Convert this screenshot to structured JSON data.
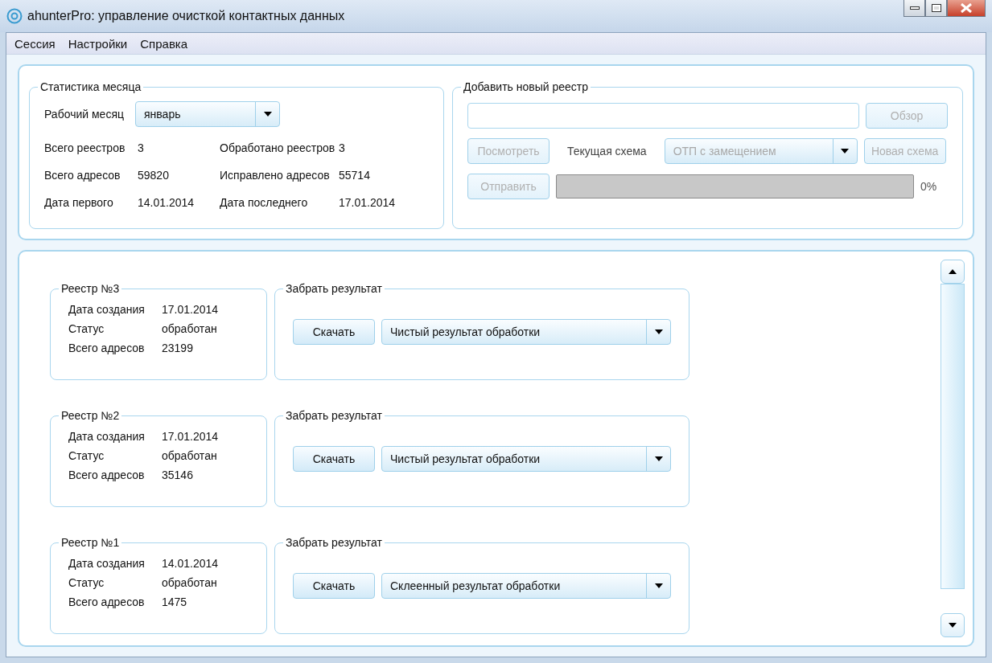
{
  "window": {
    "title": "ahunterPro: управление очисткой контактных данных"
  },
  "menu": [
    "Сессия",
    "Настройки",
    "Справка"
  ],
  "month_stats": {
    "title": "Статистика месяца",
    "month_label": "Рабочий месяц",
    "month_value": "январь",
    "stats": [
      {
        "label": "Всего реестров",
        "value": "3"
      },
      {
        "label": "Обработано реестров",
        "value": "3"
      },
      {
        "label": "Всего адресов",
        "value": "59820"
      },
      {
        "label": "Исправлено адресов",
        "value": "55714"
      },
      {
        "label": "Дата первого",
        "value": "14.01.2014"
      },
      {
        "label": "Дата последнего",
        "value": "17.01.2014"
      }
    ]
  },
  "add_registry": {
    "title": "Добавить новый реестр",
    "browse_button": {
      "label": "Обзор",
      "disabled": true
    },
    "view_button": {
      "label": "Посмотреть",
      "disabled": true
    },
    "scheme_label": "Текущая схема",
    "scheme_value": "ОТП с замещением",
    "scheme_disabled": true,
    "new_scheme_button": {
      "label": "Новая схема",
      "disabled": true
    },
    "send_button": {
      "label": "Отправить",
      "disabled": true
    },
    "progress": {
      "level": 0,
      "reading": "0%"
    }
  },
  "registries": [
    {
      "title": "Реестр №3",
      "fields": [
        {
          "label": "Дата создания",
          "value": "17.01.2014"
        },
        {
          "label": "Статус",
          "value": "обработан"
        },
        {
          "label": "Всего адресов",
          "value": "23199"
        }
      ],
      "result_title": "Забрать результат",
      "download": "Скачать",
      "result_type": "Чистый результат обработки"
    },
    {
      "title": "Реестр №2",
      "fields": [
        {
          "label": "Дата создания",
          "value": "17.01.2014"
        },
        {
          "label": "Статус",
          "value": "обработан"
        },
        {
          "label": "Всего адресов",
          "value": "35146"
        }
      ],
      "result_title": "Забрать результат",
      "download": "Скачать",
      "result_type": "Чистый результат обработки"
    },
    {
      "title": "Реестр №1",
      "fields": [
        {
          "label": "Дата создания",
          "value": "14.01.2014"
        },
        {
          "label": "Статус",
          "value": "обработан"
        },
        {
          "label": "Всего адресов",
          "value": "1475"
        }
      ],
      "result_title": "Забрать результат",
      "download": "Скачать",
      "result_type": "Склеенный результат обработки"
    }
  ]
}
